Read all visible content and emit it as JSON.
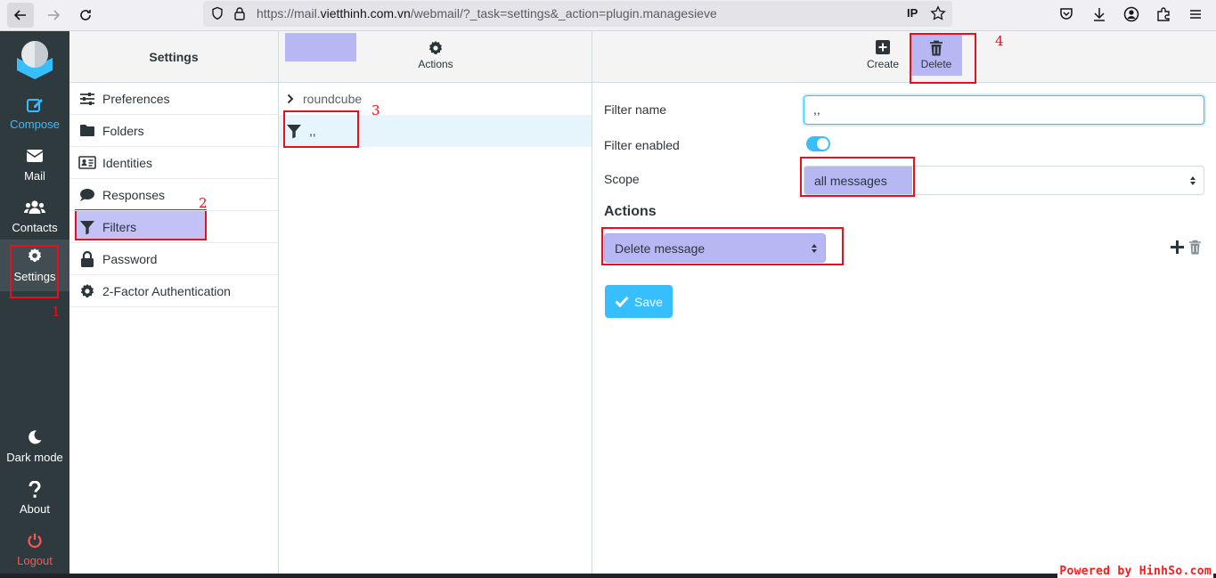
{
  "browser": {
    "url_prefix": "https://mail.",
    "url_domain": "vietthinh.com.vn",
    "url_path": "/webmail/?_task=settings&_action=plugin.managesieve",
    "ip_badge": "IP"
  },
  "rail": {
    "compose": "Compose",
    "mail": "Mail",
    "contacts": "Contacts",
    "settings": "Settings",
    "dark_mode": "Dark mode",
    "about": "About",
    "logout": "Logout"
  },
  "settings_menu": {
    "title": "Settings",
    "items": [
      {
        "label": "Preferences",
        "icon": "sliders-icon"
      },
      {
        "label": "Folders",
        "icon": "folder-icon"
      },
      {
        "label": "Identities",
        "icon": "id-card-icon"
      },
      {
        "label": "Responses",
        "icon": "comment-icon"
      },
      {
        "label": "Filters",
        "icon": "filter-icon"
      },
      {
        "label": "Password",
        "icon": "lock-icon"
      },
      {
        "label": "2-Factor Authentication",
        "icon": "gear-icon"
      }
    ]
  },
  "filters_panel": {
    "actions_label": "Actions",
    "filter_set": "roundcube",
    "filter_name": ",,"
  },
  "toolbar": {
    "create": "Create",
    "delete": "Delete"
  },
  "form": {
    "filter_name_label": "Filter name",
    "filter_name_value": ",,",
    "filter_enabled_label": "Filter enabled",
    "filter_enabled": true,
    "scope_label": "Scope",
    "scope_value": "all messages",
    "actions_title": "Actions",
    "action_value": "Delete message",
    "save_label": "Save"
  },
  "annotations": [
    "1",
    "2",
    "3",
    "4"
  ],
  "watermark": "Powered by HinhSo.com",
  "colors": {
    "accent": "#37beff",
    "highlight": "#b7b7f4",
    "annotation_red": "#e8101c",
    "rail_bg": "#2f3a3f",
    "logout_red": "#ff5552"
  }
}
